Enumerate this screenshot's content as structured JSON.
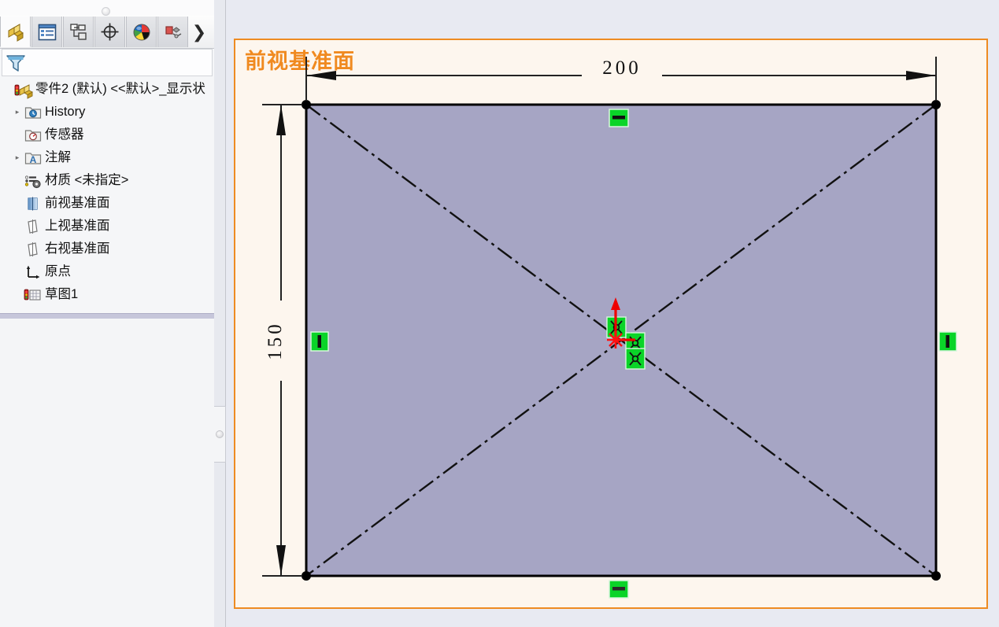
{
  "window": {
    "app": "SolidWorks",
    "document_title": "零件2 (默认) <<默认>_显示状"
  },
  "left_panel": {
    "grip_icon": "panel-collapse-dot",
    "tabs": [
      {
        "name": "feature-manager-tab",
        "icon": "feature-tree-icon",
        "label": "",
        "active": true
      },
      {
        "name": "property-manager-tab",
        "icon": "property-list-icon",
        "label": "",
        "active": false
      },
      {
        "name": "configuration-manager-tab",
        "icon": "configuration-icon",
        "label": "",
        "active": false
      },
      {
        "name": "dimxpert-manager-tab",
        "icon": "target-crosshair-icon",
        "label": "",
        "active": false
      },
      {
        "name": "display-manager-tab",
        "icon": "color-sphere-icon",
        "label": "",
        "active": false
      },
      {
        "name": "appearance-tab",
        "icon": "render-icon",
        "label": "",
        "active": false
      }
    ],
    "tab_overflow_label": "❯",
    "filter": {
      "icon": "filter-funnel-icon",
      "placeholder": "",
      "value": ""
    },
    "tree": [
      {
        "label": "零件2 (默认) <<默认>_显示状",
        "icon": "part-icon",
        "twisty": "",
        "indent": 0
      },
      {
        "label": "History",
        "icon": "history-icon",
        "twisty": "▸",
        "indent": 1
      },
      {
        "label": "传感器",
        "icon": "sensor-icon",
        "twisty": "",
        "indent": 1
      },
      {
        "label": "注解",
        "icon": "annotation-icon",
        "twisty": "▸",
        "indent": 1
      },
      {
        "label": "材质 <未指定>",
        "icon": "material-icon",
        "twisty": "",
        "indent": 1
      },
      {
        "label": "前视基准面",
        "icon": "plane-front-icon",
        "twisty": "",
        "indent": 1
      },
      {
        "label": "上视基准面",
        "icon": "plane-top-icon",
        "twisty": "",
        "indent": 1
      },
      {
        "label": "右视基准面",
        "icon": "plane-right-icon",
        "twisty": "",
        "indent": 1
      },
      {
        "label": "原点",
        "icon": "origin-icon",
        "twisty": "",
        "indent": 1
      },
      {
        "label": "草图1",
        "icon": "sketch-icon",
        "twisty": "",
        "indent": 1
      }
    ]
  },
  "graphics": {
    "plane_label": "前视基准面",
    "plane_label_color": "#f08a20",
    "frame_border_color": "#ee8b22",
    "background_color": "#fdf6ee",
    "face_fill_color": "#a6a5c4",
    "sketch": {
      "width_dimension": "200",
      "height_dimension": "150",
      "relations": [
        {
          "name": "horizontal-relation-top",
          "type": "horizontal",
          "glyph": "▬"
        },
        {
          "name": "horizontal-relation-bottom",
          "type": "horizontal",
          "glyph": "▬"
        },
        {
          "name": "vertical-relation-left",
          "type": "vertical",
          "glyph": "▮"
        },
        {
          "name": "vertical-relation-right",
          "type": "vertical",
          "glyph": "▮"
        },
        {
          "name": "midpoint-relation-1",
          "type": "midpoint",
          "glyph": "✦"
        },
        {
          "name": "midpoint-relation-2",
          "type": "midpoint",
          "glyph": "✦"
        },
        {
          "name": "midpoint-relation-3",
          "type": "midpoint",
          "glyph": "✦"
        }
      ],
      "relation_color": "#00cc22",
      "origin_color": "#ee0000"
    }
  }
}
